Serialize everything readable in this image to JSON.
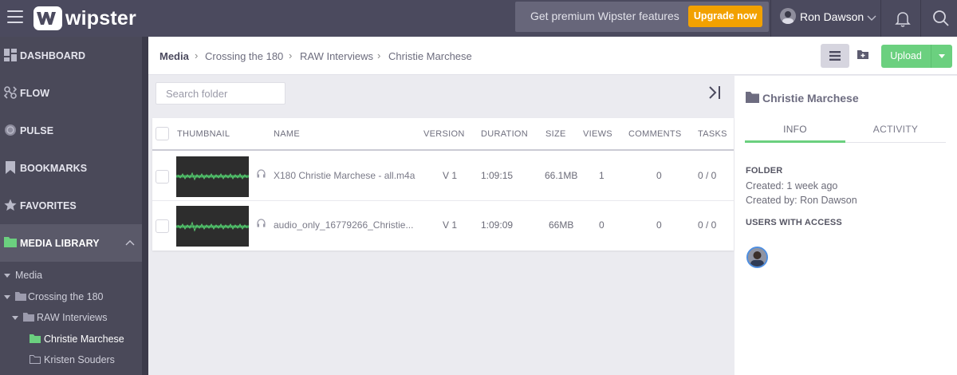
{
  "topbar": {
    "logo_text": "wipster",
    "promo_text": "Get premium Wipster features",
    "upgrade_label": "Upgrade now",
    "user_name": "Ron Dawson"
  },
  "sidebar": {
    "items": [
      {
        "label": "DASHBOARD",
        "icon": "dashboard-icon"
      },
      {
        "label": "FLOW",
        "icon": "flow-icon"
      },
      {
        "label": "PULSE",
        "icon": "pulse-icon"
      },
      {
        "label": "BOOKMARKS",
        "icon": "bookmark-icon"
      },
      {
        "label": "FAVORITES",
        "icon": "star-icon"
      },
      {
        "label": "MEDIA LIBRARY",
        "icon": "folder-icon"
      }
    ],
    "tree": [
      {
        "label": "Media"
      },
      {
        "label": "Crossing the 180"
      },
      {
        "label": "RAW Interviews"
      },
      {
        "label": "Christie Marchese"
      },
      {
        "label": "Kristen Souders"
      }
    ],
    "accent_color": "#6bd07f"
  },
  "breadcrumb": [
    "Media",
    "Crossing the 180",
    "RAW Interviews",
    "Christie Marchese"
  ],
  "toolbar": {
    "upload_label": "Upload"
  },
  "search": {
    "placeholder": "Search folder"
  },
  "table": {
    "headers": [
      "THUMBNAIL",
      "NAME",
      "VERSION",
      "DURATION",
      "SIZE",
      "VIEWS",
      "COMMENTS",
      "TASKS"
    ],
    "rows": [
      {
        "name": "X180 Christie Marchese - all.m4a",
        "version": "V 1",
        "duration": "1:09:15",
        "size": "66.1MB",
        "views": "1",
        "comments": "0",
        "tasks": "0 / 0"
      },
      {
        "name": "audio_only_16779266_Christie...",
        "version": "V 1",
        "duration": "1:09:09",
        "size": "66MB",
        "views": "0",
        "comments": "0",
        "tasks": "0 / 0"
      }
    ]
  },
  "panel": {
    "title": "Christie Marchese",
    "tabs": [
      "INFO",
      "ACTIVITY"
    ],
    "folder_label": "FOLDER",
    "created": "Created: 1 week ago",
    "created_by": "Created by: Ron Dawson",
    "users_label": "USERS WITH ACCESS"
  }
}
